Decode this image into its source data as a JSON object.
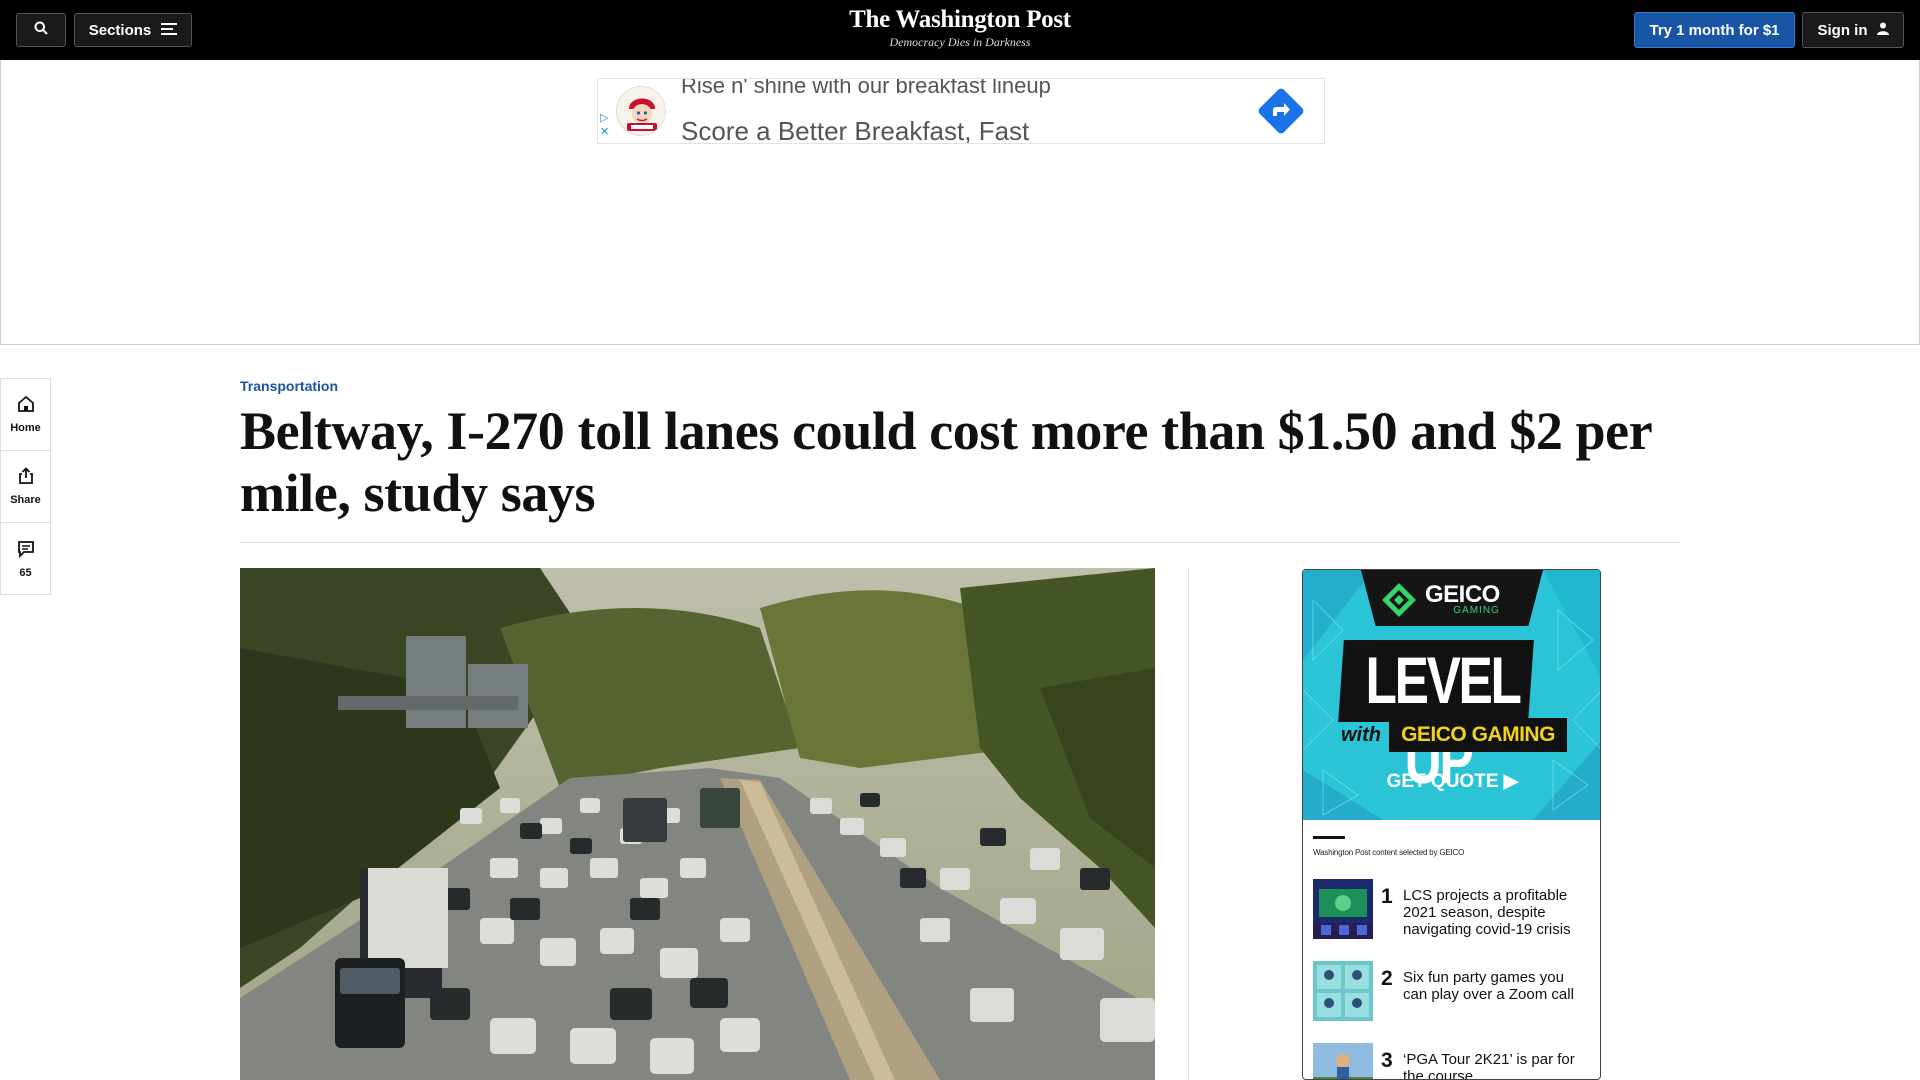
{
  "header": {
    "sections_label": "Sections",
    "logo": "The Washington Post",
    "tagline": "Democracy Dies in Darkness",
    "try_label": "Try 1 month for $1",
    "signin_label": "Sign in"
  },
  "ad_banner": {
    "line1": "Rise n' shine with our breakfast lineup",
    "line2": "Score a Better Breakfast, Fast",
    "choice_marks": "▷ ✕"
  },
  "rail": {
    "home_label": "Home",
    "share_label": "Share",
    "comments_count": "65"
  },
  "article": {
    "kicker": "Transportation",
    "headline": "Beltway, I-270 toll lanes could cost more than $1.50 and $2 per mile, study says"
  },
  "sidebar_ad": {
    "brand": "GEICO",
    "brand_sub": "GAMING",
    "level_up": "LEVEL UP",
    "with": "with",
    "geico_gaming": "GEICO GAMING",
    "get_quote": "GET QUOTE ▶",
    "selected_by": "Washington Post content selected by GEICO",
    "items": [
      {
        "num": "1",
        "title": "LCS projects a profitable 2021 season, despite navigating covid-19 crisis"
      },
      {
        "num": "2",
        "title": "Six fun party games you can play over a Zoom call"
      },
      {
        "num": "3",
        "title": "‘PGA Tour 2K21’ is par for the course"
      }
    ]
  },
  "colors": {
    "accent_blue": "#1955a5",
    "topbar": "#000000",
    "geico_teal": "#2ac1d4"
  }
}
